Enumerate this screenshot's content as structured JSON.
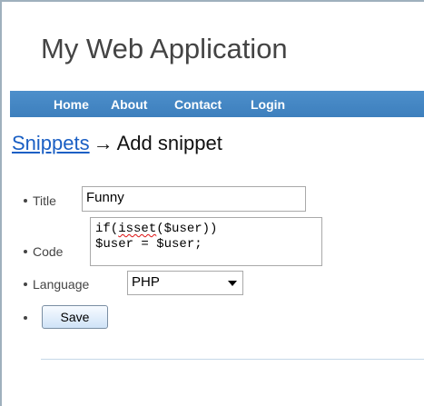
{
  "app": {
    "title": "My Web Application"
  },
  "nav": {
    "items": [
      {
        "label": "Home"
      },
      {
        "label": "About"
      },
      {
        "label": "Contact"
      },
      {
        "label": "Login"
      }
    ]
  },
  "heading": {
    "breadcrumb_link": "Snippets",
    "separator": "→",
    "current": "Add snippet"
  },
  "form": {
    "title_label": "Title",
    "title_value": "Funny",
    "code_label": "Code",
    "code_line1_prefix": "if(",
    "code_line1_misspelled": "isset",
    "code_line1_suffix": "($user))",
    "code_line2": "$user = $user;",
    "language_label": "Language",
    "language_selected": "PHP",
    "save_label": "Save"
  },
  "colors": {
    "nav_background": "#4387c7",
    "link": "#1a5fc4",
    "title_text": "#444444"
  },
  "icons": {
    "select_caret": "chevron-down-icon"
  }
}
